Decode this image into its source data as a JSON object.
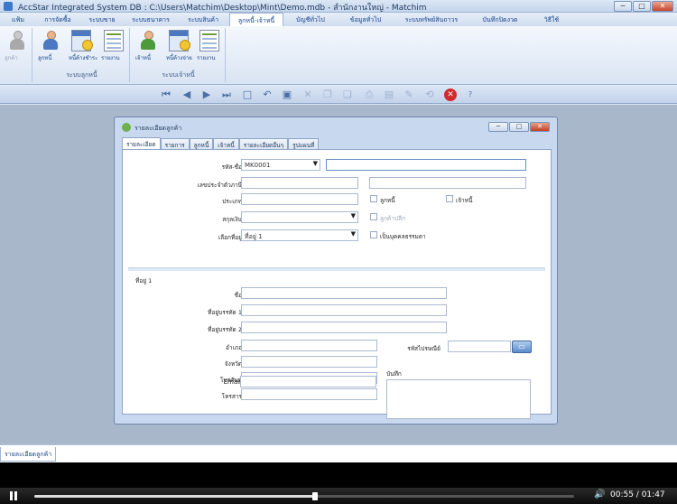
{
  "window": {
    "title": "AccStar Integrated System DB : C:\\Users\\Matchim\\Desktop\\Mint\\Demo.mdb - สำนักงานใหญ่ - Matchim",
    "minimize": "─",
    "maximize": "□",
    "close": "✕"
  },
  "menu": {
    "items": [
      {
        "label": "แฟ้ม",
        "active": false
      },
      {
        "label": "การจัดซื้อ",
        "active": false
      },
      {
        "label": "ระบบขาย",
        "active": false
      },
      {
        "label": "ระบบธนาคาร",
        "active": false
      },
      {
        "label": "ระบบสินค้า",
        "active": false
      },
      {
        "label": "ลูกหนี้-เจ้าหนี้",
        "active": true
      },
      {
        "label": "บัญชีทั่วไป",
        "active": false
      },
      {
        "label": "ข้อมูลทั่วไป",
        "active": false
      },
      {
        "label": "ระบบทรัพย์สินถาวร",
        "active": false
      },
      {
        "label": "บันทึกปิดงวด",
        "active": false
      },
      {
        "label": "วิธีใช้",
        "active": false
      }
    ]
  },
  "ribbon": {
    "groups": [
      {
        "label": "",
        "buttons": [
          {
            "label": "ลูกค้า",
            "icon": "users-icon"
          }
        ]
      },
      {
        "label": "ระบบลูกหนี้",
        "buttons": [
          {
            "label": "ลูกหนี้",
            "icon": "person-icon"
          },
          {
            "label": "หนี้ค้างชำระ",
            "icon": "calendar-icon"
          },
          {
            "label": "รายงาน",
            "icon": "report-icon"
          }
        ]
      },
      {
        "label": "ระบบเจ้าหนี้",
        "buttons": [
          {
            "label": "เจ้าหนี้",
            "icon": "person-icon"
          },
          {
            "label": "หนี้ค้างจ่าย",
            "icon": "calendar-icon"
          },
          {
            "label": "รายงาน",
            "icon": "report-icon"
          }
        ]
      }
    ]
  },
  "toolbar": {
    "first": "⏮",
    "prev": "◀",
    "next": "▶",
    "last": "⏭",
    "new": "□",
    "undo": "↶",
    "save": "▣",
    "delete": "✕",
    "copy": "❐",
    "paste": "❏",
    "print": "⎙",
    "preview": "▤",
    "edit": "✎",
    "refresh": "⟲",
    "close": "✕",
    "help": "?"
  },
  "form": {
    "title": "รายละเอียดลูกค้า",
    "tabs": [
      "รายละเอียด",
      "รายการ",
      "ลูกหนี้",
      "เจ้าหนี้",
      "รายละเอียดอื่นๆ",
      "รูปแผนที่"
    ],
    "code_name_label": "รหัส-ชื่อ",
    "code_value": "MK0001",
    "name_value": "",
    "tax_id_label": "เลขประจำตัวภาษี",
    "type_label": "ประเภท",
    "currency_label": "สกุลเงิน",
    "address_select_label": "เลือกที่อยู่",
    "address_select_value": "ที่อยู่ 1",
    "debtor_label": "ลูกหนี้",
    "creditor_label": "เจ้าหนี้",
    "retail_label": "ลูกค้าปลีก",
    "person_label": "เป็นบุคคลธรรมดา",
    "address_section_title": "ที่อยู่ 1",
    "name_label": "ชื่อ",
    "addr1_label": "ที่อยู่บรรทัด 1",
    "addr2_label": "ที่อยู่บรรทัด 2",
    "district_label": "อำเภอ",
    "province_label": "จังหวัด",
    "phone_label": "โทรศัพท์",
    "fax_label": "โทรสาร",
    "email_label": "Email",
    "postcode_label": "รหัสไปรษณีย์",
    "notes_label": "บันทึก"
  },
  "status": {
    "tab_label": "รายละเอียดลูกค้า"
  },
  "player": {
    "current": "00:55",
    "total": "01:47",
    "progress": 0.52,
    "volume_icon": "🔊"
  }
}
